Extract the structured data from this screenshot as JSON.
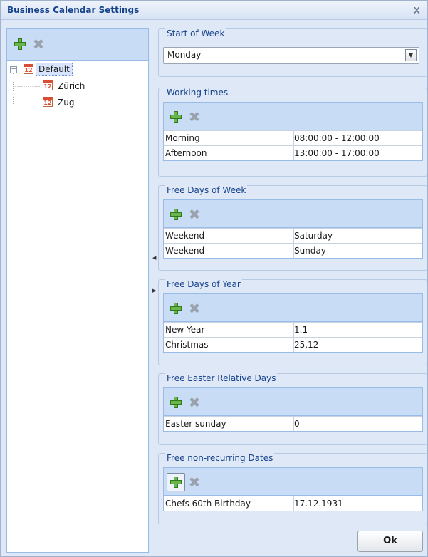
{
  "window": {
    "title": "Business Calendar Settings",
    "close_glyph": "x"
  },
  "tree": {
    "items": [
      {
        "label": "Default",
        "expander": "−",
        "icon": "calendar-icon",
        "selected": true
      },
      {
        "label": "Zürich",
        "icon": "calendar-icon"
      },
      {
        "label": "Zug",
        "icon": "calendar-icon"
      }
    ],
    "icon_text": "12"
  },
  "start_of_week": {
    "title": "Start of Week",
    "value": "Monday"
  },
  "working_times": {
    "title": "Working times",
    "rows": [
      [
        "Morning",
        "08:00:00 - 12:00:00"
      ],
      [
        "Afternoon",
        "13:00:00 - 17:00:00"
      ]
    ]
  },
  "free_days_week": {
    "title": "Free Days of Week",
    "rows": [
      [
        "Weekend",
        "Saturday"
      ],
      [
        "Weekend",
        "Sunday"
      ]
    ]
  },
  "free_days_year": {
    "title": "Free Days of Year",
    "rows": [
      [
        "New Year",
        "1.1"
      ],
      [
        "Christmas",
        "25.12"
      ]
    ]
  },
  "easter_days": {
    "title": "Free Easter Relative Days",
    "rows": [
      [
        "Easter sunday",
        "0"
      ]
    ]
  },
  "nonrecurring": {
    "title": "Free non-recurring Dates",
    "rows": [
      [
        "Chefs 60th Birthday",
        "17.12.1931"
      ]
    ]
  },
  "ok_label": "Ok",
  "colors": {
    "accent": "#15428b",
    "toolbar": "#c9dcf6",
    "background": "#dfe8f6",
    "add_green": "#6bb64a"
  }
}
